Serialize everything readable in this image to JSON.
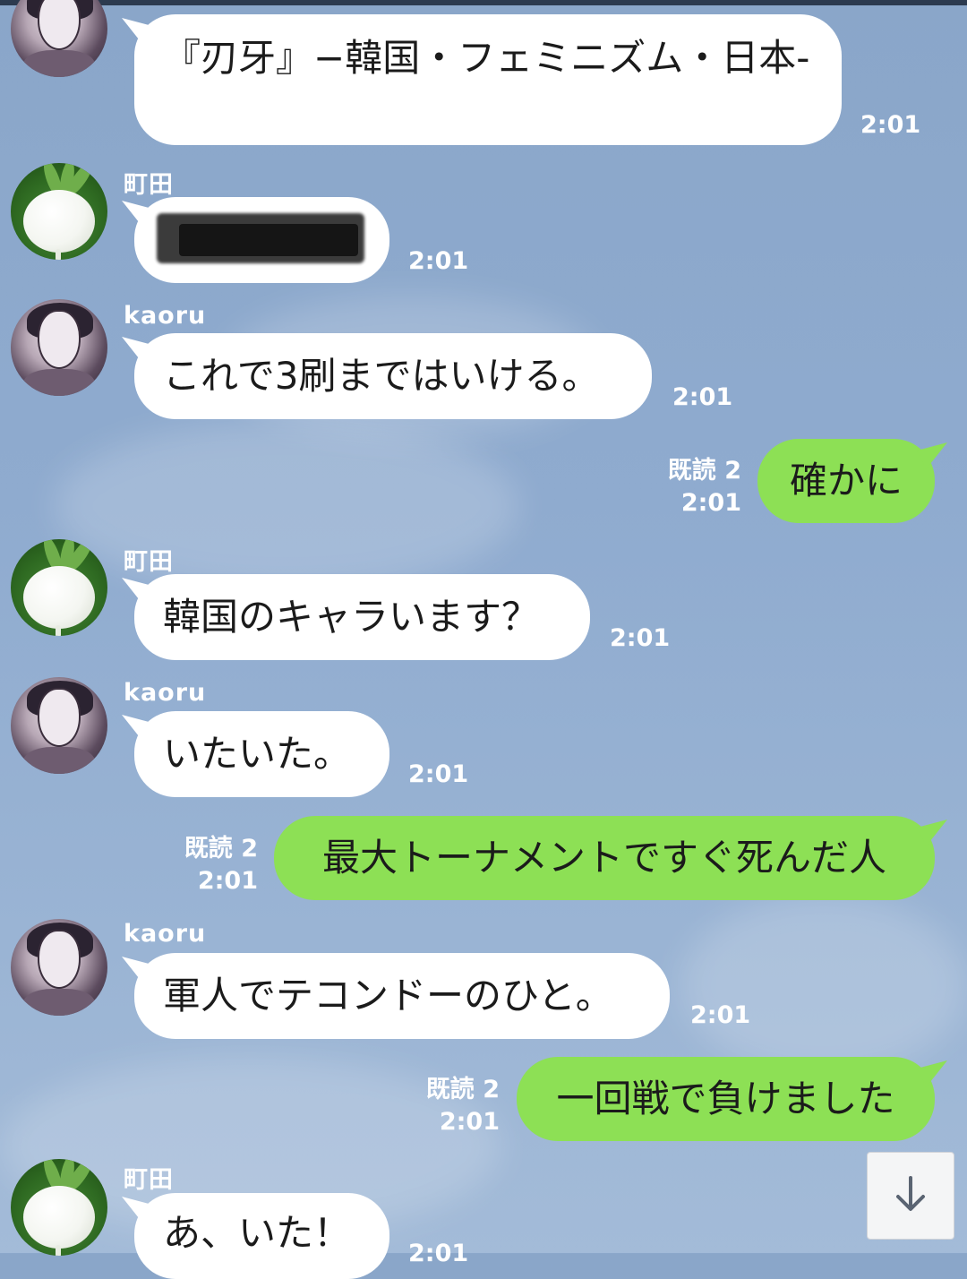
{
  "messages": [
    {
      "sender": "",
      "text": "『刃牙』−韓国・フェミニズム・日本-",
      "time": "2:01"
    },
    {
      "sender": "町田",
      "text": "",
      "time": "2:01"
    },
    {
      "sender": "kaoru",
      "text": "これで3刷まではいける。",
      "time": "2:01"
    },
    {
      "sender": "me",
      "text": "確かに",
      "read": "既読 2",
      "time": "2:01"
    },
    {
      "sender": "町田",
      "text": "韓国のキャラいます？",
      "time": "2:01"
    },
    {
      "sender": "kaoru",
      "text": "いたいた。",
      "time": "2:01"
    },
    {
      "sender": "me",
      "text": "最大トーナメントですぐ死んだ人",
      "read": "既読 2",
      "time": "2:01"
    },
    {
      "sender": "kaoru",
      "text": "軍人でテコンドーのひと。",
      "time": "2:01"
    },
    {
      "sender": "me",
      "text": "一回戦で負けました",
      "read": "既読 2",
      "time": "2:01"
    },
    {
      "sender": "町田",
      "text": "あ、いた！",
      "time": "2:01"
    }
  ],
  "icons": {
    "scroll_down": "arrow-down-icon",
    "avatar_kaoru": "manga-portrait",
    "avatar_machida": "turnip"
  },
  "colors": {
    "background": "#8fabcf",
    "incoming_bubble": "#ffffff",
    "outgoing_bubble": "#8de055",
    "text_on_bg": "#ffffff"
  }
}
